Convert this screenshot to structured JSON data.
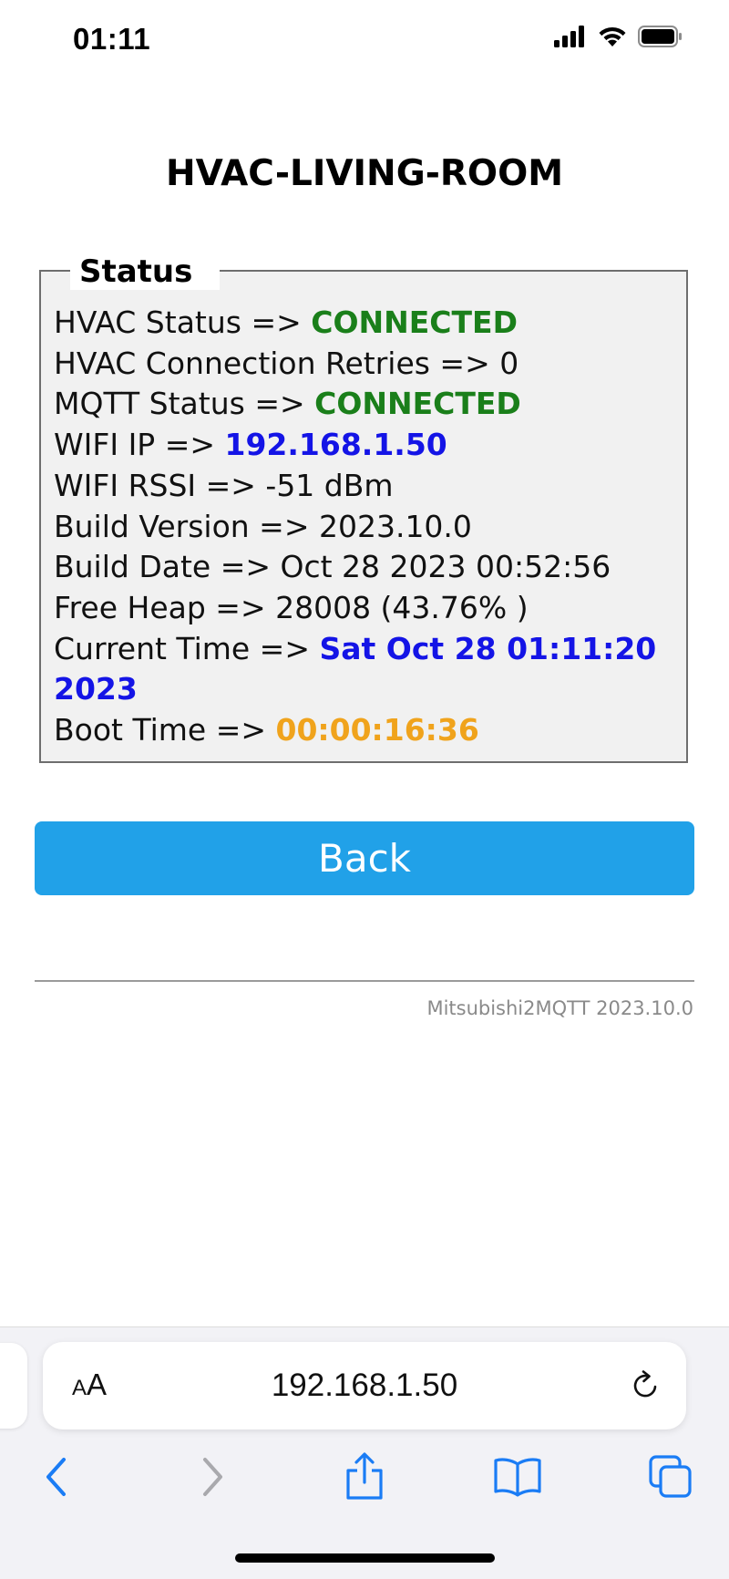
{
  "status_bar": {
    "time": "01:11",
    "icons": [
      "signal-icon",
      "wifi-icon",
      "battery-icon"
    ]
  },
  "page": {
    "title": "HVAC-LIVING-ROOM",
    "status_legend": "Status",
    "status": {
      "hvac_status": {
        "label": "HVAC Status => ",
        "value": "CONNECTED"
      },
      "retries": {
        "label": "HVAC Connection Retries => ",
        "value": "0"
      },
      "mqtt_status": {
        "label": "MQTT Status => ",
        "value": "CONNECTED"
      },
      "wifi_ip": {
        "label": "WIFI IP => ",
        "value": "192.168.1.50"
      },
      "wifi_rssi": {
        "label": "WIFI RSSI => ",
        "value": "-51 dBm"
      },
      "build_version": {
        "label": "Build Version => ",
        "value": "2023.10.0"
      },
      "build_date": {
        "label": "Build Date => ",
        "value": "Oct 28 2023 00:52:56"
      },
      "free_heap": {
        "label": "Free Heap => ",
        "value": "28008 (43.76% )"
      },
      "current_time": {
        "label": "Current Time => ",
        "value": "Sat Oct 28 01:11:20 2023"
      },
      "boot_time": {
        "label": "Boot Time => ",
        "value": "00:00:16:36"
      }
    },
    "back_button": "Back",
    "footer_version": "Mitsubishi2MQTT 2023.10.0"
  },
  "browser": {
    "text_size_small": "A",
    "text_size_big": "A",
    "url": "192.168.1.50",
    "toolbar": [
      "back-icon",
      "forward-icon",
      "share-icon",
      "bookmarks-icon",
      "tabs-icon"
    ]
  },
  "colors": {
    "connected": "#1a7f1a",
    "highlight_blue": "#1414e6",
    "uptime_orange": "#f0a31c",
    "button_blue": "#21a1e8",
    "ios_blue": "#1a7cf5"
  }
}
